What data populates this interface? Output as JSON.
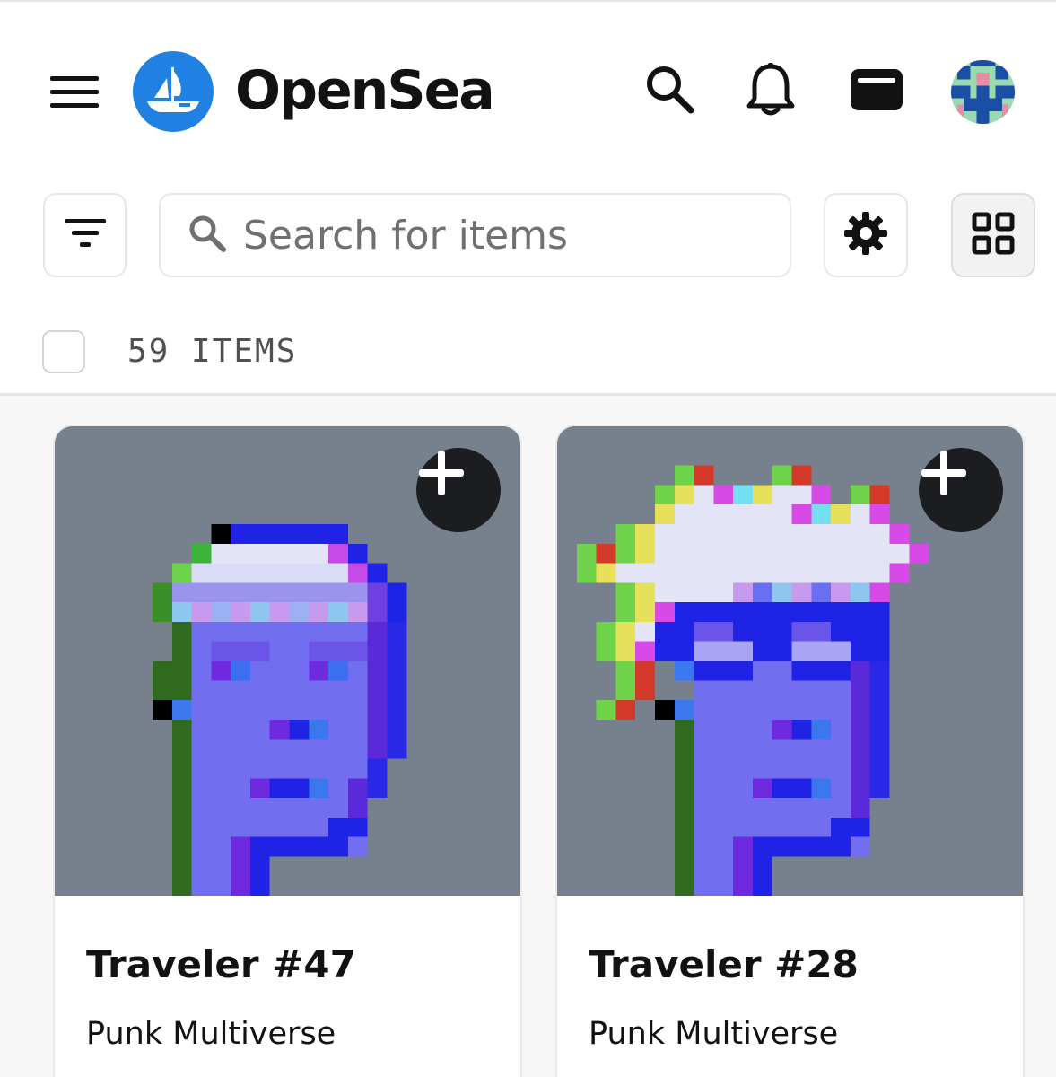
{
  "header": {
    "brand": "OpenSea",
    "icons": {
      "menu": "hamburger-menu-icon",
      "logo": "opensea-ship-logo",
      "search": "search-icon",
      "notifications": "bell-icon",
      "wallet": "wallet-icon",
      "avatar": "user-avatar"
    }
  },
  "toolbar": {
    "filter_icon": "filter-icon",
    "search_placeholder": "Search for items",
    "search_value": "",
    "settings_icon": "gear-icon",
    "view_icon": "grid-view-icon"
  },
  "items": {
    "count_label": "59 ITEMS"
  },
  "cards": [
    {
      "title": "Traveler #47",
      "collection": "Punk Multiverse",
      "add_icon": "plus-icon"
    },
    {
      "title": "Traveler #28",
      "collection": "Punk Multiverse",
      "add_icon": "plus-icon"
    }
  ],
  "colors": {
    "brand_blue": "#2081e2",
    "card_bg": "#76818d",
    "text": "#121212",
    "muted": "#707070"
  }
}
